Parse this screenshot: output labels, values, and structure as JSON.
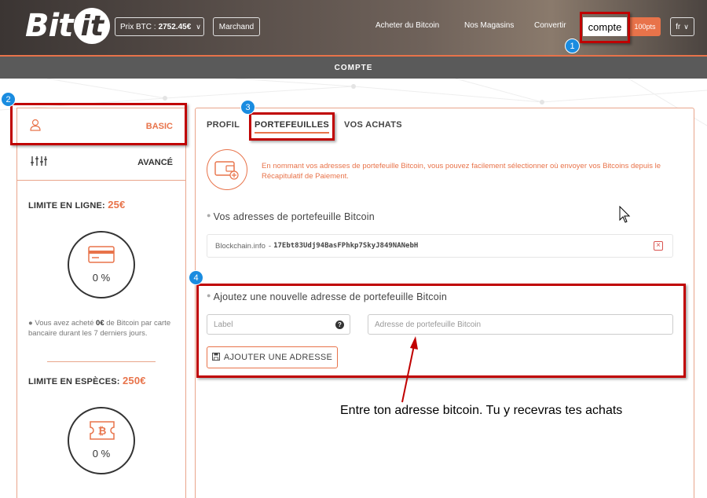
{
  "header": {
    "logo": "Bitit",
    "price_label": "Prix BTC :",
    "price_value": "2752.45€",
    "merchant_label": "Marchand",
    "nav": [
      "Acheter du Bitcoin",
      "Nos Magasins",
      "Convertir"
    ],
    "account_label": "compte",
    "points_badge": "100pts",
    "language": "fr"
  },
  "page_title": "COMPTE",
  "sidebar": {
    "tiers": [
      {
        "label": "BASIC",
        "icon": "user-icon"
      },
      {
        "label": "AVANCÉ",
        "icon": "sliders-icon"
      }
    ],
    "limits": [
      {
        "title": "LIMITE EN LIGNE:",
        "amount": "25€",
        "icon": "credit-card-icon",
        "percent": "0 %",
        "note_prefix": "Vous avez acheté",
        "note_amount": "0€",
        "note_suffix": "de Bitcoin par carte bancaire durant les 7 derniers jours."
      },
      {
        "title": "LIMITE EN ESPÈCES:",
        "amount": "250€",
        "icon": "bitcoin-ticket-icon",
        "percent": "0 %"
      }
    ]
  },
  "main": {
    "tabs": [
      {
        "label": "PROFIL",
        "active": false
      },
      {
        "label": "PORTEFEUILLES",
        "active": true
      },
      {
        "label": "VOS ACHATS",
        "active": false
      }
    ],
    "info_text": "En nommant vos adresses de portefeuille Bitcoin, vous pouvez facilement sélectionner où envoyer vos Bitcoins depuis le Récapitulatif de Paiement.",
    "wallets_title": "Vos adresses de portefeuille Bitcoin",
    "wallets": [
      {
        "label": "Blockchain.info",
        "separator": "-",
        "address": "17Ebt83Udj94BasFPhkp7SkyJ849NANebH"
      }
    ],
    "add_title": "Ajoutez une nouvelle adresse de portefeuille Bitcoin",
    "label_placeholder": "Label",
    "address_placeholder": "Adresse de portefeuille Bitcoin",
    "add_button": "AJOUTER UNE ADRESSE"
  },
  "annotations": {
    "markers": [
      "1",
      "2",
      "3",
      "4"
    ],
    "caption": "Entre ton adresse bitcoin. Tu y recevras tes achats",
    "box_color": "#c00000",
    "marker_color": "#1a8ce0"
  },
  "colors": {
    "accent": "#e8734a",
    "header_dark": "#3b3533",
    "title_bar": "#5a5a5a"
  }
}
